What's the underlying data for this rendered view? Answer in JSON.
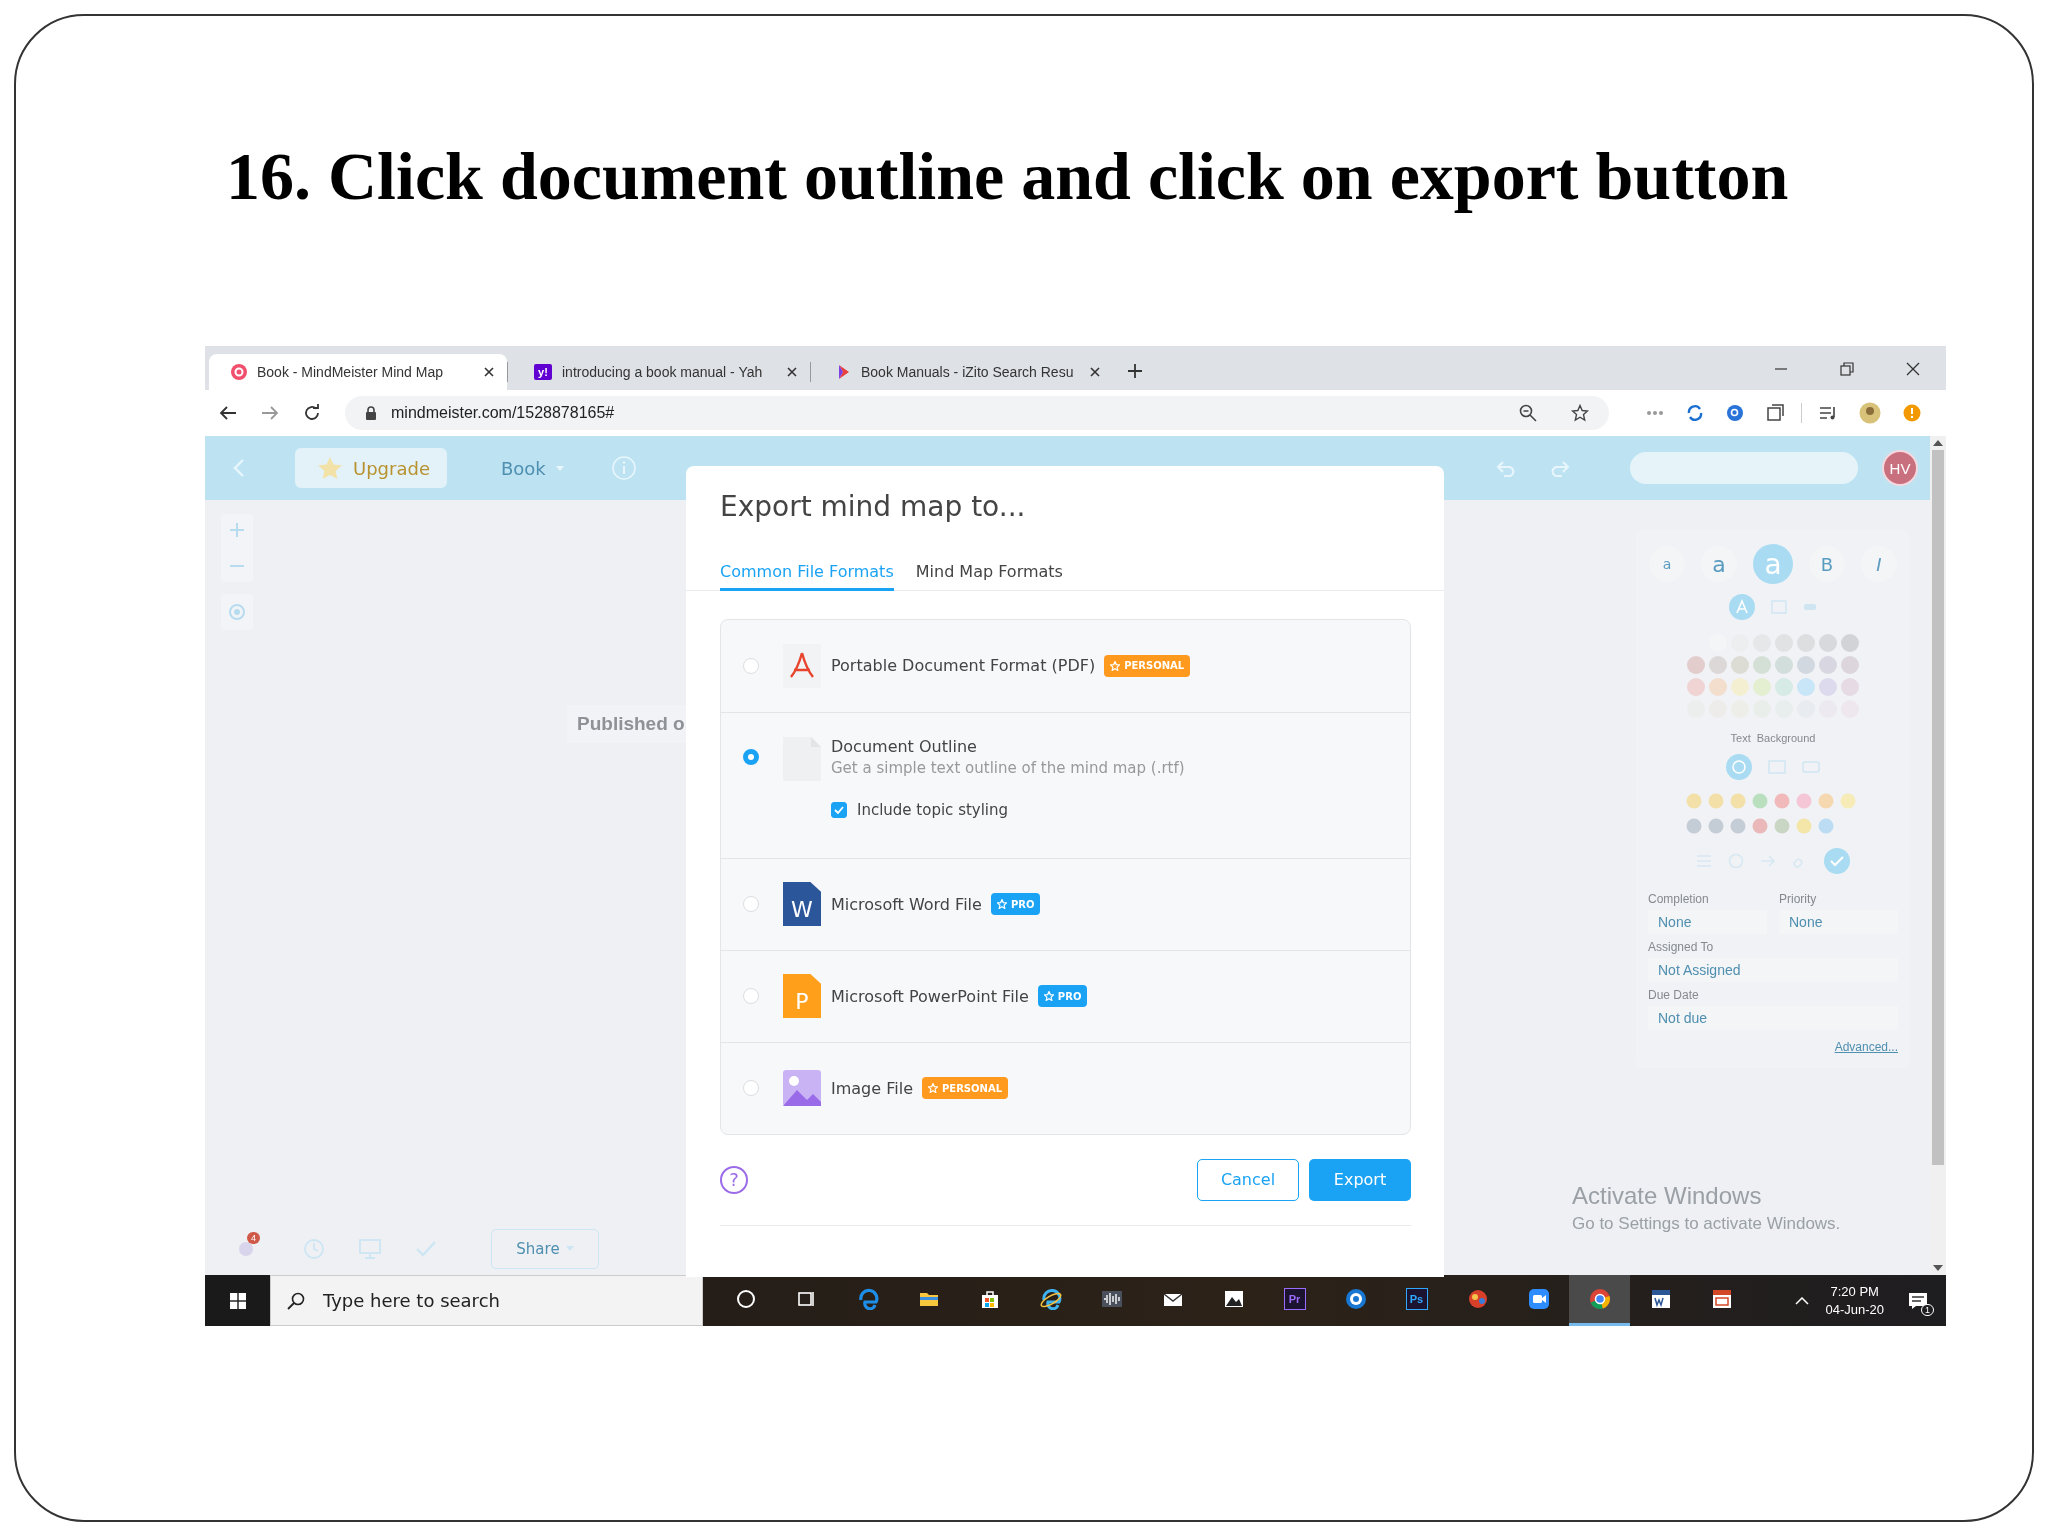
{
  "slide": {
    "title": "16. Click document outline and click on export button"
  },
  "browser": {
    "tabs": [
      {
        "title": "Book - MindMeister Mind Map",
        "kind": "mindmeister",
        "selected": true
      },
      {
        "title": "introducing a book manual - Yah",
        "kind": "yahoo",
        "icon_text": "y!",
        "selected": false
      },
      {
        "title": "Book Manuals - iZito Search Resu",
        "kind": "izito",
        "selected": false
      }
    ],
    "address": "mindmeister.com/1528878165#"
  },
  "app": {
    "upgrade": "Upgrade",
    "map_title": "Book",
    "avatar": "HV",
    "canvas_label": "Published o",
    "notification_badge": "4",
    "share": "Share",
    "panel": {
      "text_sizes": [
        {
          "label": "a",
          "selected": false
        },
        {
          "label": "a",
          "selected": false
        },
        {
          "label": "a",
          "selected": true
        }
      ],
      "text_styles": [
        "B",
        "I"
      ],
      "color_labels": [
        "Text",
        "Background"
      ],
      "fields": [
        {
          "label": "Completion",
          "value": "None"
        },
        {
          "label": "Priority",
          "value": "None"
        },
        {
          "label": "Assigned To",
          "value": "Not Assigned"
        },
        {
          "label": "Due Date",
          "value": "Not due"
        }
      ],
      "advanced_link": "Advanced..."
    }
  },
  "dialog": {
    "title": "Export mind map to...",
    "tabs": [
      {
        "label": "Common File Formats",
        "selected": true
      },
      {
        "label": "Mind Map Formats",
        "selected": false
      }
    ],
    "options": [
      {
        "kind": "pdf",
        "label": "Portable Document Format (PDF)",
        "badge": {
          "kind": "personal",
          "text": "PERSONAL"
        },
        "selected": false
      },
      {
        "kind": "outline",
        "label": "Document Outline",
        "description": "Get a simple text outline of the mind map (.rtf)",
        "checkbox": {
          "label": "Include topic styling",
          "checked": true
        },
        "selected": true
      },
      {
        "kind": "word",
        "label": "Microsoft Word File",
        "icon_text": "W",
        "badge": {
          "kind": "pro",
          "text": "PRO"
        },
        "selected": false
      },
      {
        "kind": "powerpoint",
        "label": "Microsoft PowerPoint File",
        "icon_text": "P",
        "badge": {
          "kind": "pro",
          "text": "PRO"
        },
        "selected": false
      },
      {
        "kind": "image",
        "label": "Image File",
        "badge": {
          "kind": "personal",
          "text": "PERSONAL"
        },
        "selected": false
      }
    ],
    "help": "?",
    "cancel": "Cancel",
    "export": "Export"
  },
  "activation_notice": {
    "title": "Activate Windows",
    "text": "Go to Settings to activate Windows."
  },
  "taskbar": {
    "search_placeholder": "Type here to search",
    "apps": [
      {
        "kind": "cortana",
        "selected": false
      },
      {
        "kind": "taskview",
        "selected": false
      },
      {
        "kind": "edge",
        "selected": false
      },
      {
        "kind": "folder",
        "selected": false
      },
      {
        "kind": "store",
        "selected": false
      },
      {
        "kind": "ie",
        "selected": false
      },
      {
        "kind": "audio",
        "selected": false
      },
      {
        "kind": "mail",
        "selected": false
      },
      {
        "kind": "photos",
        "selected": false
      },
      {
        "kind": "lettered",
        "text": "Pr",
        "color": "#9a6bff",
        "selected": false
      },
      {
        "kind": "ring",
        "selected": false
      },
      {
        "kind": "lettered",
        "text": "Ps",
        "color": "#31a8ff",
        "selected": false
      },
      {
        "kind": "game",
        "selected": false
      },
      {
        "kind": "video",
        "selected": false
      },
      {
        "kind": "chrome",
        "selected": true
      },
      {
        "kind": "word",
        "selected": false
      },
      {
        "kind": "presentation",
        "selected": false
      }
    ],
    "time": "7:20 PM",
    "date": "04-Jun-20",
    "notification_count": "1"
  }
}
